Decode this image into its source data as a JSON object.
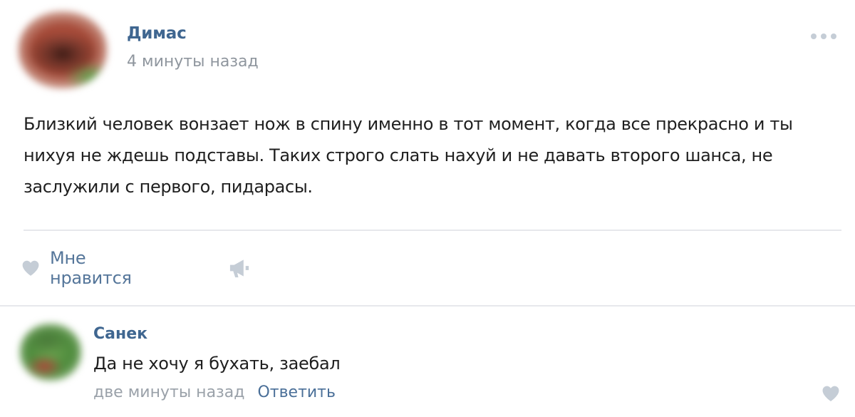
{
  "post": {
    "author": "Димас",
    "time": "4 минуты назад",
    "text": "Близкий человек вонзает нож в спину именно в тот момент, когда все прекрасно и ты нихуя не ждешь подставы. Таких строго слать нахуй и не давать второго шанса, не заслужили с первого, пидарасы.",
    "like_label": "Мне нравится",
    "icons": {
      "more": "more-dots-icon",
      "like": "heart-icon",
      "share": "megaphone-icon"
    }
  },
  "comment": {
    "author": "Санек",
    "text": "Да не хочу я бухать, заебал",
    "time": "две минуты назад",
    "reply_label": "Ответить",
    "icons": {
      "like": "heart-icon"
    }
  },
  "colors": {
    "link": "#3f6690",
    "muted": "#8f969e",
    "icon": "#c5cdd6",
    "divider": "#e7e8ec"
  }
}
